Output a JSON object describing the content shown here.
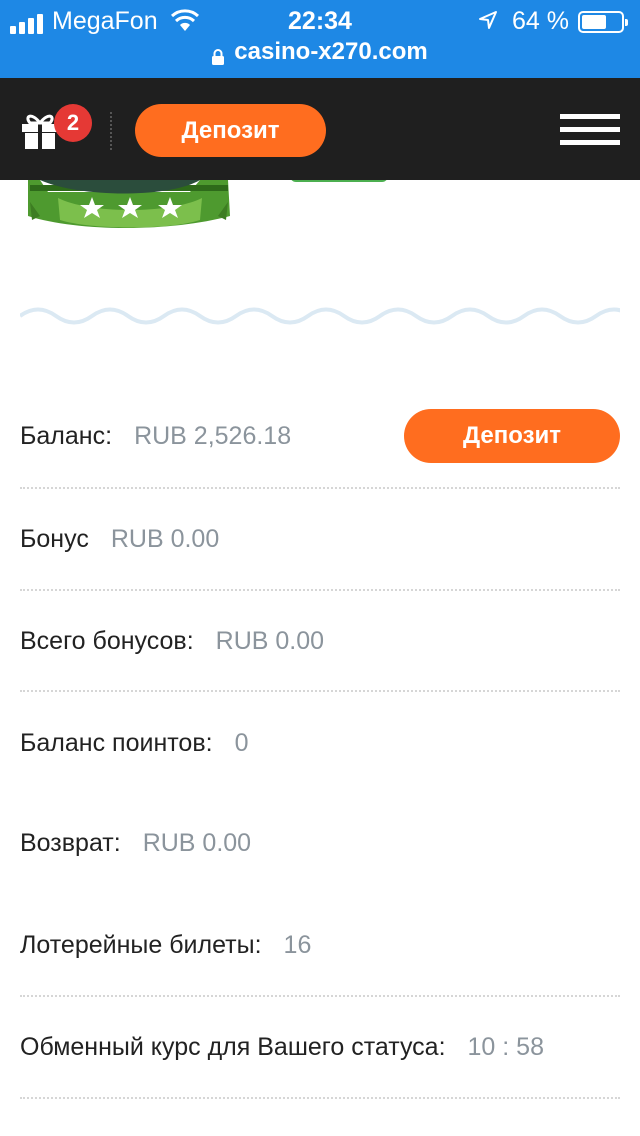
{
  "statusbar": {
    "carrier": "MegaFon",
    "time": "22:34",
    "battery": "64 %",
    "battery_level": 0.64,
    "url": "casino-x270.com"
  },
  "header": {
    "notifications_count": "2",
    "deposit_label": "Депозит"
  },
  "account": {
    "deposit_label": "Депозит",
    "rows": [
      {
        "label": "Баланс:",
        "value": "RUB 2,526.18"
      },
      {
        "label": "Бонус",
        "value": "RUB 0.00"
      },
      {
        "label": "Всего бонусов:",
        "value": "RUB 0.00"
      },
      {
        "label": "Баланс поинтов:",
        "value": "0"
      },
      {
        "label": "Возврат:",
        "value": "RUB 0.00"
      },
      {
        "label": "Лотерейные билеты:",
        "value": "16"
      },
      {
        "label": "Обменный курс для Вашего статуса:",
        "value": "10 : 58"
      }
    ]
  },
  "colors": {
    "statusbar": "#1e88e5",
    "topbar": "#1f1f1f",
    "accent": "#ff6d1f",
    "badge": "#e53935",
    "value_text": "#8b949c",
    "wave": "#dbe9f3",
    "rank_badge_green": "#4caf50"
  }
}
